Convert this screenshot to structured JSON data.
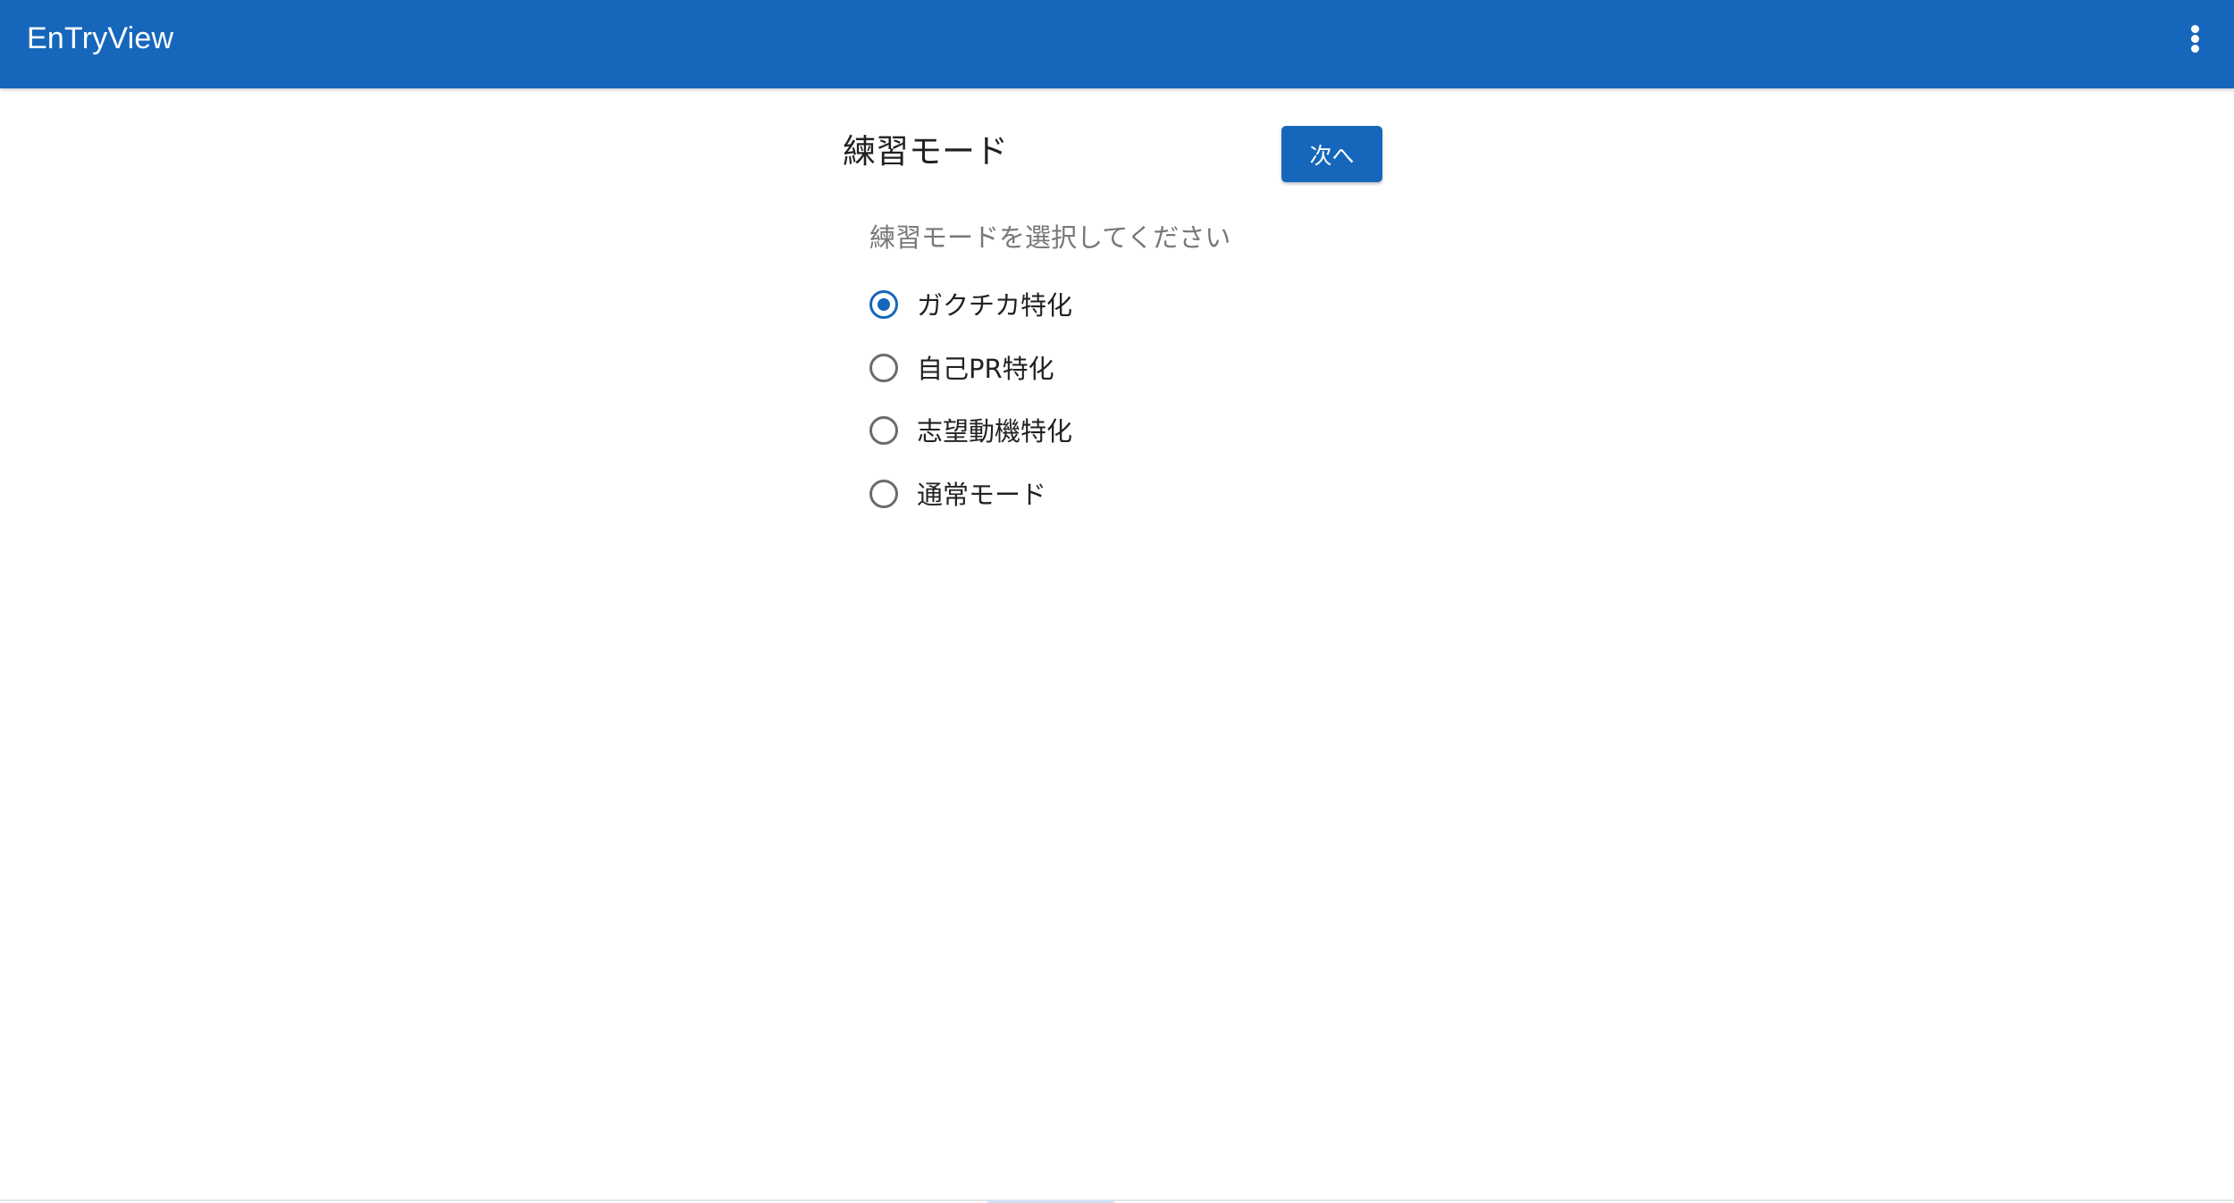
{
  "appbar": {
    "title": "EnTryView",
    "background_color": "#1667bc",
    "menu_icon": "more-vert-icon"
  },
  "main": {
    "page_title": "練習モード",
    "next_button_label": "次へ",
    "group_label": "練習モードを選択してください",
    "options": [
      {
        "label": "ガクチカ特化",
        "selected": true
      },
      {
        "label": "自己PR特化",
        "selected": false
      },
      {
        "label": "志望動機特化",
        "selected": false
      },
      {
        "label": "通常モード",
        "selected": false
      }
    ],
    "accent_color": "#1667bc"
  }
}
